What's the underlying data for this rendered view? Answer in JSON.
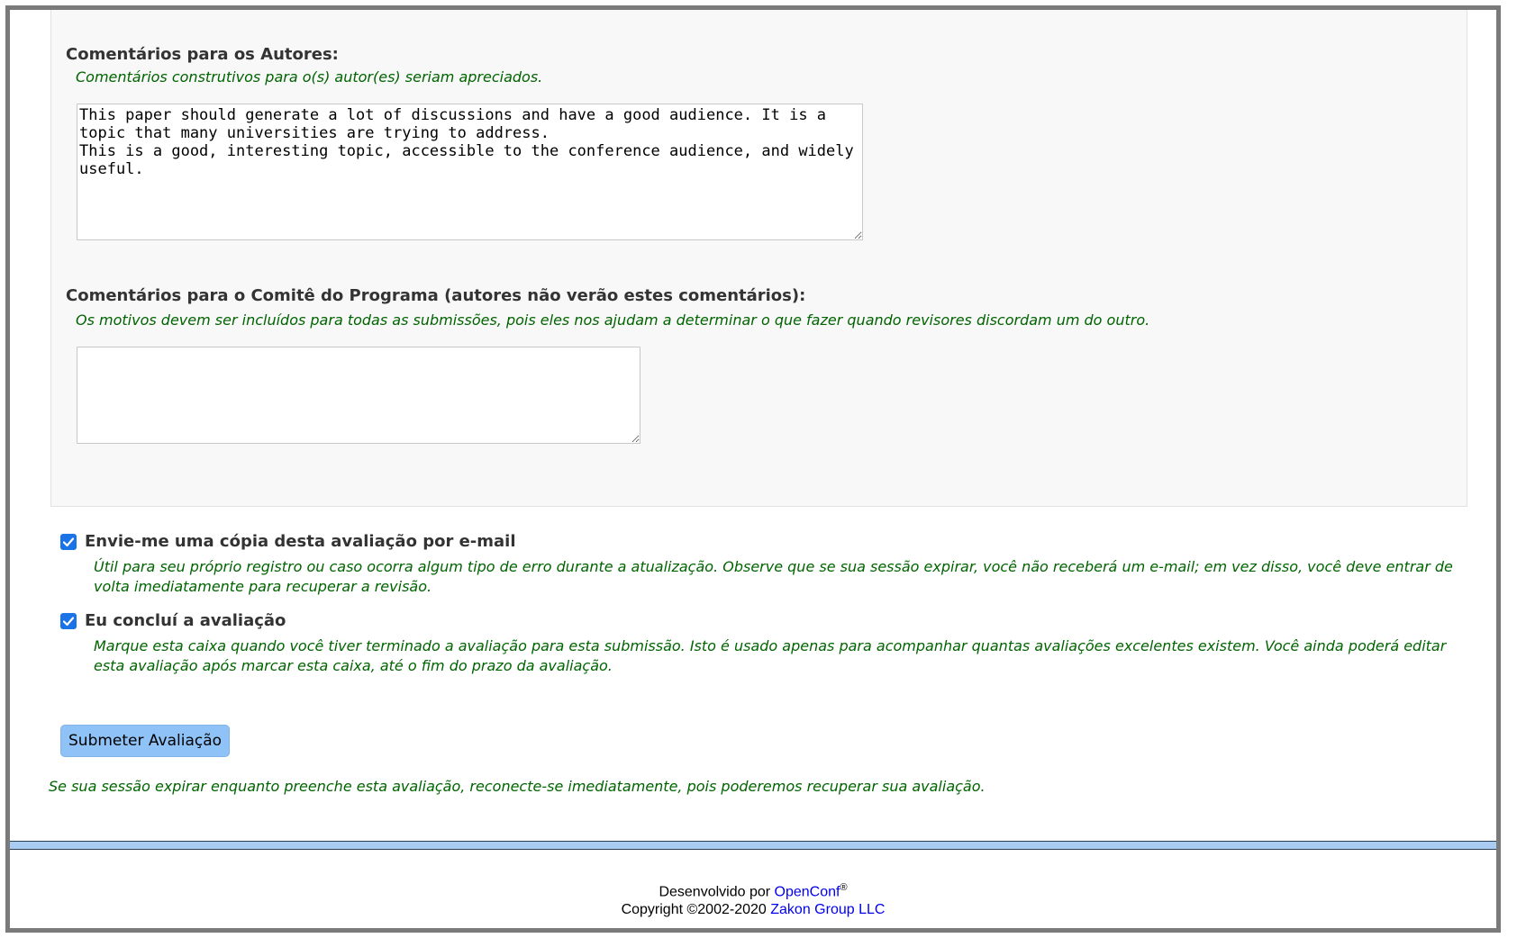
{
  "authors_section": {
    "label": "Comentários para os Autores:",
    "hint": "Comentários construtivos para o(s) autor(es) seriam apreciados.",
    "value": "This paper should generate a lot of discussions and have a good audience. It is a topic that many universities are trying to address.\nThis is a good, interesting topic, accessible to the conference audience, and widely useful."
  },
  "committee_section": {
    "label": "Comentários para o Comitê do Programa (autores não verão estes comentários):",
    "hint": "Os motivos devem ser incluídos para todas as submissões, pois eles nos ajudam a determinar o que fazer quando revisores discordam um do outro.",
    "value": ""
  },
  "options": {
    "email_copy": {
      "label": "Envie-me uma cópia desta avaliação por e-mail",
      "hint": "Útil para seu próprio registro ou caso ocorra algum tipo de erro durante a atualização. Observe que se sua sessão expirar, você não receberá um e-mail; em vez disso, você deve entrar de volta imediatamente para recuperar a revisão.",
      "checked": true
    },
    "completed": {
      "label": "Eu concluí a avaliação",
      "hint": "Marque esta caixa quando você tiver terminado a avaliação para esta submissão. Isto é usado apenas para acompanhar quantas avaliações excelentes existem. Você ainda poderá editar esta avaliação após marcar esta caixa, até o fim do prazo da avaliação.",
      "checked": true
    }
  },
  "submit_label": "Submeter Avaliação",
  "session_hint": "Se sua sessão expirar enquanto preenche esta avaliação, reconecte-se imediatamente, pois poderemos recuperar sua avaliação.",
  "footer": {
    "developed_by": "Desenvolvido por",
    "openconf_link": "OpenConf",
    "registered_mark": "®",
    "copyright": "Copyright ©2002-2020",
    "company_link": "Zakon Group LLC"
  },
  "colors": {
    "hint_green": "#006400",
    "checkbox_blue": "#1b73e8",
    "button_blue": "#8fc3f7",
    "rule_blue": "#a9ccf2",
    "link_blue": "#0000ee"
  }
}
